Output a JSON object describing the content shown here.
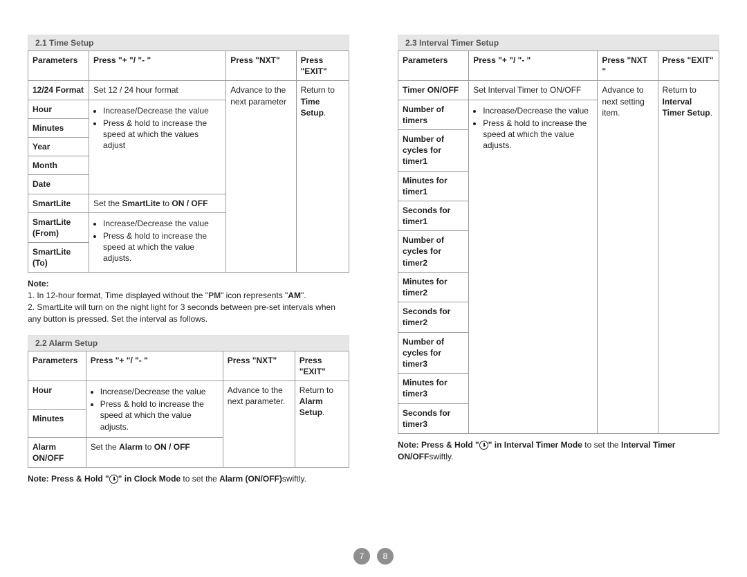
{
  "page_numbers": [
    "7",
    "8"
  ],
  "time_setup": {
    "title": "2.1 Time Setup",
    "headers": [
      "Parameters",
      "Press \"+ \"/ \"- \"",
      "Press \"NXT\"",
      "Press \"EXIT\""
    ],
    "rows": {
      "r1_param": "12/24 Format",
      "r1_action": "Set 12 / 24 hour format",
      "r2_param": "Hour",
      "r3_param": "Minutes",
      "r4_param": "Year",
      "r5_param": "Month",
      "r6_param": "Date",
      "group_action_1": "Increase/Decrease the value",
      "group_action_2": "Press & hold to increase the speed at which the values adjust",
      "r7_param": "SmartLite",
      "r7_action_pre": "Set the ",
      "r7_action_bold": "SmartLite",
      "r7_action_post": " to ",
      "r7_action_onoff": "ON / OFF",
      "r8_param": "SmartLite (From)",
      "r9_param": "SmartLite (To)",
      "sl_action_1": "Increase/Decrease the value",
      "sl_action_2": "Press & hold to increase the speed at which the value adjusts.",
      "nxt": "Advance to the next parameter",
      "exit_pre": "Return to ",
      "exit_bold": "Time Setup",
      "exit_post": "."
    },
    "notes": {
      "label": "Note:",
      "n1_pre": "1. In 12-hour format, Time displayed without the \"",
      "n1_bold": "PM",
      "n1_mid": "\" icon represents \"",
      "n1_bold2": "AM",
      "n1_post": "\".",
      "n2": "2. SmartLite will turn on the night light for 3 seconds between pre-set intervals when any button is pressed. Set the interval as follows."
    }
  },
  "alarm_setup": {
    "title": "2.2 Alarm Setup",
    "headers": [
      "Parameters",
      "Press \"+ \"/ \"- \"",
      "Press \"NXT\"",
      "Press \"EXIT\""
    ],
    "rows": {
      "r1_param": "Hour",
      "r2_param": "Minutes",
      "group_action_1": "Increase/Decrease the value",
      "group_action_2": "Press & hold to increase the speed at which the value adjusts.",
      "r3_param": "Alarm ON/OFF",
      "r3_action_pre": "Set the ",
      "r3_action_bold": "Alarm",
      "r3_action_post": " to ",
      "r3_action_onoff": "ON / OFF",
      "nxt": "Advance to the next parameter.",
      "exit_pre": "Return to ",
      "exit_bold": "Alarm Setup",
      "exit_post": "."
    },
    "note": {
      "pre": "Note: Press & Hold \"",
      "mid": "\" in ",
      "clockmode": "Clock Mode",
      "mid2": " to set the ",
      "bold": "Alarm (ON/OFF)",
      "post": "swiftly."
    }
  },
  "interval_setup": {
    "title": "2.3 Interval Timer Setup",
    "headers": [
      "Parameters",
      "Press \"+ \"/ \"- \"",
      "Press \"NXT \"",
      "Press \"EXIT\""
    ],
    "rows": {
      "r1_param": "Timer ON/OFF",
      "r1_action": "Set Interval Timer to ON/OFF",
      "r2_param": "Number of timers",
      "r3_param": "Number of cycles for timer1",
      "r4_param": "Minutes for timer1",
      "r5_param": "Seconds for timer1",
      "r6_param": "Number of cycles for timer2",
      "r7_param": "Minutes for timer2",
      "r8_param": "Seconds for timer2",
      "r9_param": "Number of cycles for timer3",
      "r10_param": "Minutes for timer3",
      "r11_param": "Seconds for timer3",
      "group_action_1": "Increase/Decrease the value",
      "group_action_2": "Press & hold to increase the speed at which the value adjusts.",
      "nxt": "Advance to next setting item.",
      "exit_pre": "Return to ",
      "exit_bold": "Interval Timer Setup",
      "exit_post": "."
    },
    "note": {
      "pre": "Note: Press & Hold \"",
      "mid": "\" in ",
      "mode": "Interval Timer Mode",
      "mid2": " to set the ",
      "bold": "Interval Timer ON/OFF",
      "post": "swiftly."
    }
  }
}
